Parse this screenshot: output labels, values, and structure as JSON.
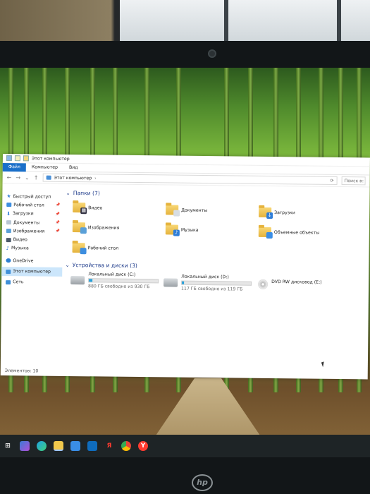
{
  "window": {
    "title": "Этот компьютер",
    "tabs": [
      "Файл",
      "Компьютер",
      "Вид"
    ],
    "address": "Этот компьютер",
    "search_placeholder": "Поиск в:"
  },
  "sidebar": {
    "items": [
      {
        "label": "Быстрый доступ",
        "icon": "star-icon",
        "pinned": false,
        "selected": false
      },
      {
        "label": "Рабочий стол",
        "icon": "desktop-icon",
        "pinned": true,
        "selected": false
      },
      {
        "label": "Загрузки",
        "icon": "download-icon",
        "pinned": true,
        "selected": false
      },
      {
        "label": "Документы",
        "icon": "document-icon",
        "pinned": true,
        "selected": false
      },
      {
        "label": "Изображения",
        "icon": "image-icon",
        "pinned": true,
        "selected": false
      },
      {
        "label": "Видео",
        "icon": "video-icon",
        "pinned": false,
        "selected": false
      },
      {
        "label": "Музыка",
        "icon": "music-icon",
        "pinned": false,
        "selected": false
      },
      {
        "label": "OneDrive",
        "icon": "cloud-icon",
        "pinned": false,
        "selected": false
      },
      {
        "label": "Этот компьютер",
        "icon": "computer-icon",
        "pinned": false,
        "selected": true
      },
      {
        "label": "Сеть",
        "icon": "network-icon",
        "pinned": false,
        "selected": false
      }
    ]
  },
  "folders_group": {
    "title": "Папки (7)"
  },
  "folders": [
    {
      "name": "Видео",
      "icon": "video-folder-icon"
    },
    {
      "name": "Документы",
      "icon": "documents-folder-icon"
    },
    {
      "name": "Загрузки",
      "icon": "downloads-folder-icon"
    },
    {
      "name": "Изображения",
      "icon": "pictures-folder-icon"
    },
    {
      "name": "Музыка",
      "icon": "music-folder-icon"
    },
    {
      "name": "Объемные объекты",
      "icon": "3d-objects-folder-icon"
    },
    {
      "name": "Рабочий стол",
      "icon": "desktop-folder-icon"
    }
  ],
  "drives_group": {
    "title": "Устройства и диски (3)"
  },
  "drives": [
    {
      "name": "Локальный диск (C:)",
      "free": "880 ГБ свободно из 930 ГБ",
      "used_fraction": 0.054,
      "icon": "hard-drive-icon"
    },
    {
      "name": "Локальный диск (D:)",
      "free": "117 ГБ свободно из 119 ГБ",
      "used_fraction": 0.017,
      "icon": "hard-drive-icon"
    },
    {
      "name": "DVD RW дисковод (E:)",
      "free": "",
      "used_fraction": null,
      "icon": "dvd-drive-icon"
    }
  ],
  "status": {
    "items": "Элементов: 10"
  },
  "taskbar": {
    "icons": [
      "windows-icon",
      "copilot-icon",
      "edge-icon",
      "file-explorer-icon",
      "store-icon",
      "outlook-icon",
      "yandex-icon",
      "chrome-icon",
      "yandex-browser-icon"
    ]
  },
  "laptop": {
    "logo": "hp"
  }
}
